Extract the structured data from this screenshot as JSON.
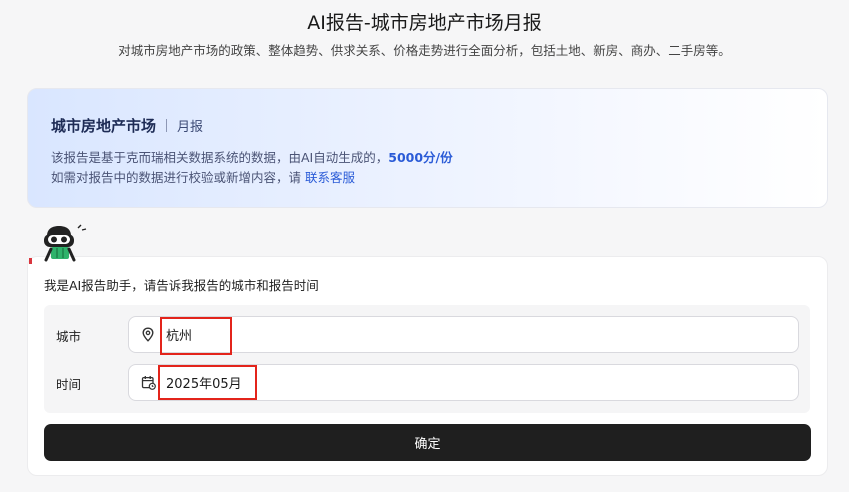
{
  "header": {
    "title": "AI报告-城市房地产市场月报",
    "subtitle": "对城市房地产市场的政策、整体趋势、供求关系、价格走势进行全面分析，包括土地、新房、商办、二手房等。"
  },
  "info_card": {
    "title": "城市房地产市场",
    "tag": "月报",
    "line1_prefix": "该报告是基于克而瑞相关数据系统的数据，由AI自动生成的，",
    "price": "5000分/份",
    "line2_prefix": "如需对报告中的数据进行校验或新增内容，请 ",
    "service_link": "联系客服"
  },
  "assistant": {
    "icon": "robot-icon",
    "message": "我是AI报告助手，请告诉我报告的城市和报告时间"
  },
  "form": {
    "city": {
      "label": "城市",
      "value": "杭州",
      "icon": "location-pin-icon"
    },
    "time": {
      "label": "时间",
      "value": "2025年05月",
      "icon": "calendar-icon"
    },
    "submit_label": "确定"
  },
  "colors": {
    "accent": "#2a5bd7",
    "button": "#1f1f1f",
    "highlight": "#e3241b",
    "bot_green": "#2fb36b"
  }
}
